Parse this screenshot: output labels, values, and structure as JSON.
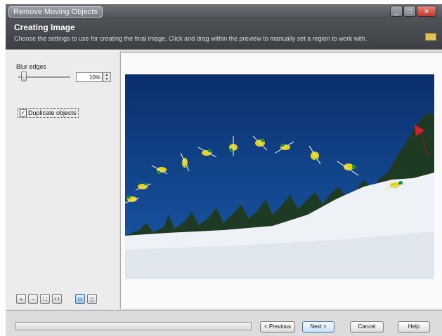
{
  "window": {
    "title": "Remove Moving Objects",
    "controls": [
      "minimize",
      "maximize",
      "close"
    ]
  },
  "header": {
    "title": "Creating Image",
    "subtitle": "Choose the settings to use for creating the final image. Click and drag within the preview to manually set a region to work with."
  },
  "settings": {
    "blur_label": "Blur edges",
    "blur_value": "10%",
    "blur_level_fraction": 0.1,
    "duplicate_label": "Duplicate objects",
    "duplicate_checked": true
  },
  "toolbar": {
    "tools": [
      {
        "name": "zoom-in-icon",
        "glyph": "+"
      },
      {
        "name": "zoom-out-icon",
        "glyph": "−"
      },
      {
        "name": "fit-icon",
        "glyph": "⛶"
      },
      {
        "name": "actual-size-icon",
        "glyph": "1:1"
      },
      {
        "name": "single-view-icon",
        "glyph": "▭",
        "active": true
      },
      {
        "name": "split-view-icon",
        "glyph": "▯"
      }
    ]
  },
  "footer": {
    "previous_label": "< Previous",
    "next_label": "Next >",
    "cancel_label": "Cancel",
    "help_label": "Help"
  },
  "colors": {
    "sky": "#0f3f8a",
    "snow": "#eef2f6",
    "header_bg": "#45494e",
    "accent": "#3a75b5"
  }
}
